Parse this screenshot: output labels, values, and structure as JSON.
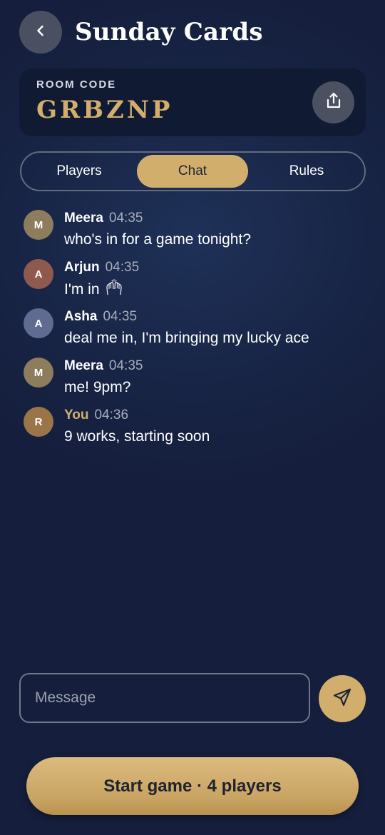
{
  "header": {
    "title": "Sunday Cards",
    "back_icon": "chevron-left-icon"
  },
  "room": {
    "label": "ROOM CODE",
    "code": "GRBZNP",
    "share_icon": "share-icon"
  },
  "tabs": [
    {
      "label": "Players",
      "active": false
    },
    {
      "label": "Chat",
      "active": true
    },
    {
      "label": "Rules",
      "active": false
    }
  ],
  "messages": [
    {
      "initial": "M",
      "name": "Meera",
      "time": "04:35",
      "text": "who's in for a game tonight?",
      "avatar_color": "#8d7d5d",
      "is_you": false
    },
    {
      "initial": "A",
      "name": "Arjun",
      "time": "04:35",
      "text": "I'm in",
      "emoji": "raised-hands-icon",
      "avatar_color": "#8f5a4d",
      "is_you": false
    },
    {
      "initial": "A",
      "name": "Asha",
      "time": "04:35",
      "text": "deal me in, I'm bringing my lucky ace",
      "avatar_color": "#5f6b91",
      "is_you": false
    },
    {
      "initial": "M",
      "name": "Meera",
      "time": "04:35",
      "text": "me! 9pm?",
      "avatar_color": "#8d7d5d",
      "is_you": false
    },
    {
      "initial": "R",
      "name": "You",
      "time": "04:36",
      "text": "9 works, starting soon",
      "avatar_color": "#9a7548",
      "is_you": true
    }
  ],
  "composer": {
    "placeholder": "Message",
    "value": "",
    "send_icon": "send-icon"
  },
  "start_button": {
    "label": "Start game · 4 players"
  },
  "colors": {
    "accent": "#d2ae6c",
    "background": "#182546"
  }
}
